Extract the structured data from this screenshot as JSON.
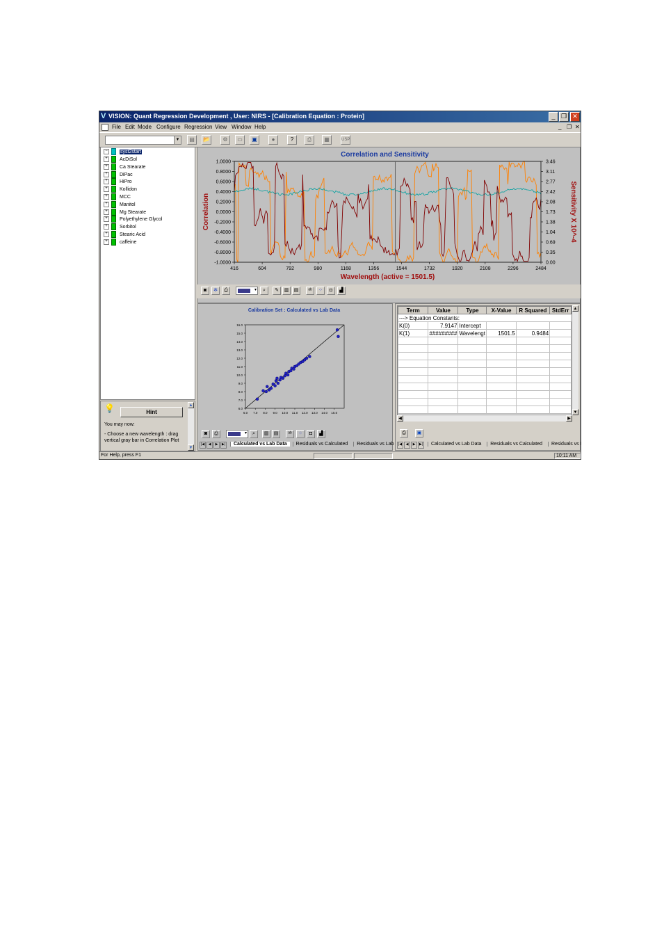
{
  "window": {
    "title": "VISION: Quant Regression Development , User: NIRS - [Calibration Equation : Protein]",
    "logo": "V",
    "controls": {
      "minimize": "_",
      "restore": "❐",
      "close": "✕"
    }
  },
  "menu": {
    "items": [
      "File",
      "Edit",
      "Mode",
      "Configure",
      "Regression",
      "View",
      "Window",
      "Help"
    ],
    "mdi_controls": [
      "_",
      "❐",
      "✕"
    ]
  },
  "toolbar": {
    "combo_value": "",
    "buttons": [
      "doc-icon",
      "open-icon",
      "gear-icon",
      "folder-icon",
      "save-icon",
      "info-icon",
      "help-icon",
      "print-icon",
      "report-icon",
      "usp-icon"
    ],
    "usp_label": "USP"
  },
  "tree": {
    "root": "syst2start",
    "items": [
      "AcDiSol",
      "Ca Stearate",
      "DiPac",
      "HiPro",
      "Kollidon",
      "MCC",
      "Manitol",
      "Mg Stearate",
      "Polyethylene Glycol",
      "Sorbitol",
      "Stearic Acid",
      "caffeine"
    ]
  },
  "hint": {
    "button": "Hint",
    "line1": "You may now:",
    "line2": "- Choose a new wavelength : drag vertical gray bar in Correlation Plot"
  },
  "chart_data": [
    {
      "type": "line",
      "title": "Correlation and Sensitivity",
      "xlabel": "Wavelength (active = 1501.5)",
      "ylabel": "Correlation",
      "y2label": "Sensitivity X 10^-4",
      "x_ticks": [
        "416",
        "604",
        "792",
        "980",
        "1168",
        "1356",
        "1544",
        "1732",
        "1920",
        "2108",
        "2296",
        "2484"
      ],
      "y_ticks": [
        "1.0000",
        "0.8000",
        "0.6000",
        "0.4000",
        "0.2000",
        "0.0000",
        "-0.2000",
        "-0.4000",
        "-0.6000",
        "-0.8000",
        "-1.0000"
      ],
      "y2_ticks": [
        "3.46",
        "3.11",
        "2.77",
        "2.42",
        "2.08",
        "1.73",
        "1.38",
        "1.04",
        "0.69",
        "0.35",
        "0.00"
      ],
      "xlim": [
        416,
        2484
      ],
      "ylim": [
        -1.0,
        1.0
      ],
      "y2lim": [
        0.0,
        3.46
      ],
      "active_wavelength": 1501.5,
      "colors": {
        "correlation": "#800000",
        "sensitivity": "#ff8000",
        "teal": "#00a0a0"
      }
    },
    {
      "type": "scatter",
      "title": "Calibration Set : Calculated vs Lab Data",
      "x_ticks": [
        "6.0",
        "7.0",
        "8.0",
        "9.0",
        "10.0",
        "11.0",
        "12.0",
        "13.0",
        "14.0",
        "15.0"
      ],
      "y_ticks": [
        "16.0",
        "15.0",
        "14.0",
        "13.0",
        "12.0",
        "11.0",
        "10.0",
        "9.0",
        "8.0",
        "7.0",
        "6.0"
      ],
      "xlim": [
        6.0,
        16.0
      ],
      "ylim": [
        6.0,
        16.0
      ],
      "points": [
        [
          7.2,
          7.1
        ],
        [
          7.8,
          8.1
        ],
        [
          8.1,
          8.0
        ],
        [
          8.4,
          8.2
        ],
        [
          8.6,
          8.4
        ],
        [
          8.8,
          8.9
        ],
        [
          9.0,
          8.7
        ],
        [
          9.1,
          9.3
        ],
        [
          9.3,
          9.0
        ],
        [
          9.5,
          9.4
        ],
        [
          9.6,
          9.7
        ],
        [
          9.8,
          9.6
        ],
        [
          10.0,
          9.9
        ],
        [
          10.1,
          10.2
        ],
        [
          10.3,
          10.0
        ],
        [
          10.4,
          10.4
        ],
        [
          10.6,
          10.5
        ],
        [
          10.7,
          10.8
        ],
        [
          10.9,
          10.7
        ],
        [
          11.0,
          11.0
        ],
        [
          11.2,
          11.1
        ],
        [
          11.4,
          11.3
        ],
        [
          11.6,
          11.5
        ],
        [
          11.8,
          11.6
        ],
        [
          12.0,
          11.8
        ],
        [
          12.2,
          12.0
        ],
        [
          12.5,
          12.2
        ],
        [
          15.3,
          15.4
        ],
        [
          15.4,
          14.6
        ],
        [
          8.2,
          8.6
        ],
        [
          9.2,
          9.6
        ]
      ],
      "fit_line": [
        [
          6.0,
          6.0
        ],
        [
          16.0,
          16.0
        ]
      ],
      "colors": {
        "points": "#2020c0",
        "line": "#000000"
      }
    }
  ],
  "results": {
    "columns": [
      "Term",
      "Value",
      "Type",
      "X-Value",
      "R Squared",
      "StdErr"
    ],
    "rows": [
      [
        "---> Equation Constants:",
        "",
        "",
        "",
        "",
        ""
      ],
      [
        "K(0)",
        "7.9147",
        "Intercept",
        "",
        "",
        ""
      ],
      [
        "K(1)",
        "#########",
        "Wavelengt",
        "1501.5",
        "0.9484",
        ""
      ]
    ]
  },
  "bottom_left_tabs": [
    "Calculated vs Lab Data",
    "Residuals vs Calculated",
    "Residuals vs Lab I"
  ],
  "bottom_right_tabs": [
    "Calculated vs Lab Data",
    "Residuals vs Calculated",
    "Residuals vs I"
  ],
  "status": {
    "help": "For Help, press F1",
    "time": "10:11 AM"
  }
}
